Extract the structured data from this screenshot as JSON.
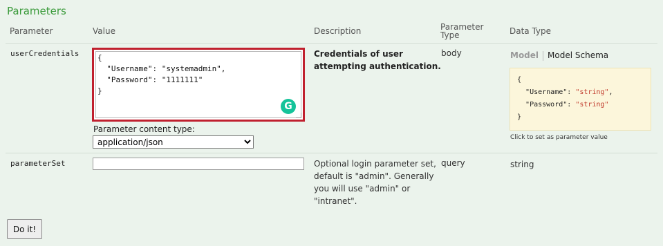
{
  "section_title": "Parameters",
  "headers": {
    "parameter": "Parameter",
    "value": "Value",
    "description": "Description",
    "parameter_type_line1": "Parameter",
    "parameter_type_line2": "Type",
    "data_type": "Data Type"
  },
  "rows": [
    {
      "name": "userCredentials",
      "value_lines": [
        "{",
        "  \"Username\": \"systemadmin\",",
        "  \"Password\": \"1111111\"",
        "}"
      ],
      "content_type_label": "Parameter content type:",
      "content_type_selected": "application/json",
      "description_lines": [
        "Credentials of user",
        "attempting authentication."
      ],
      "param_type": "body",
      "tab_model": "Model",
      "tab_model_schema": "Model Schema",
      "schema": {
        "open": "{",
        "username_key": "\"Username\"",
        "username_type": "\"string\"",
        "password_key": "\"Password\"",
        "password_type": "\"string\"",
        "close": "}"
      },
      "hint": "Click to set as parameter value"
    },
    {
      "name": "parameterSet",
      "value": "",
      "description_lines": [
        "Optional login parameter set,",
        "default is \"admin\". Generally",
        "you will use \"admin\" or",
        "\"intranet\"."
      ],
      "param_type": "query",
      "data_type": "string"
    }
  ],
  "submit_label": "Do it!",
  "colors": {
    "background": "#ebf3ec",
    "title_green": "#3a9a3a",
    "highlight_border": "#c0202e",
    "schema_bg": "#fcf6db",
    "grammarly_green": "#15c39a"
  },
  "icons": {
    "grammarly": "grammarly-icon"
  }
}
